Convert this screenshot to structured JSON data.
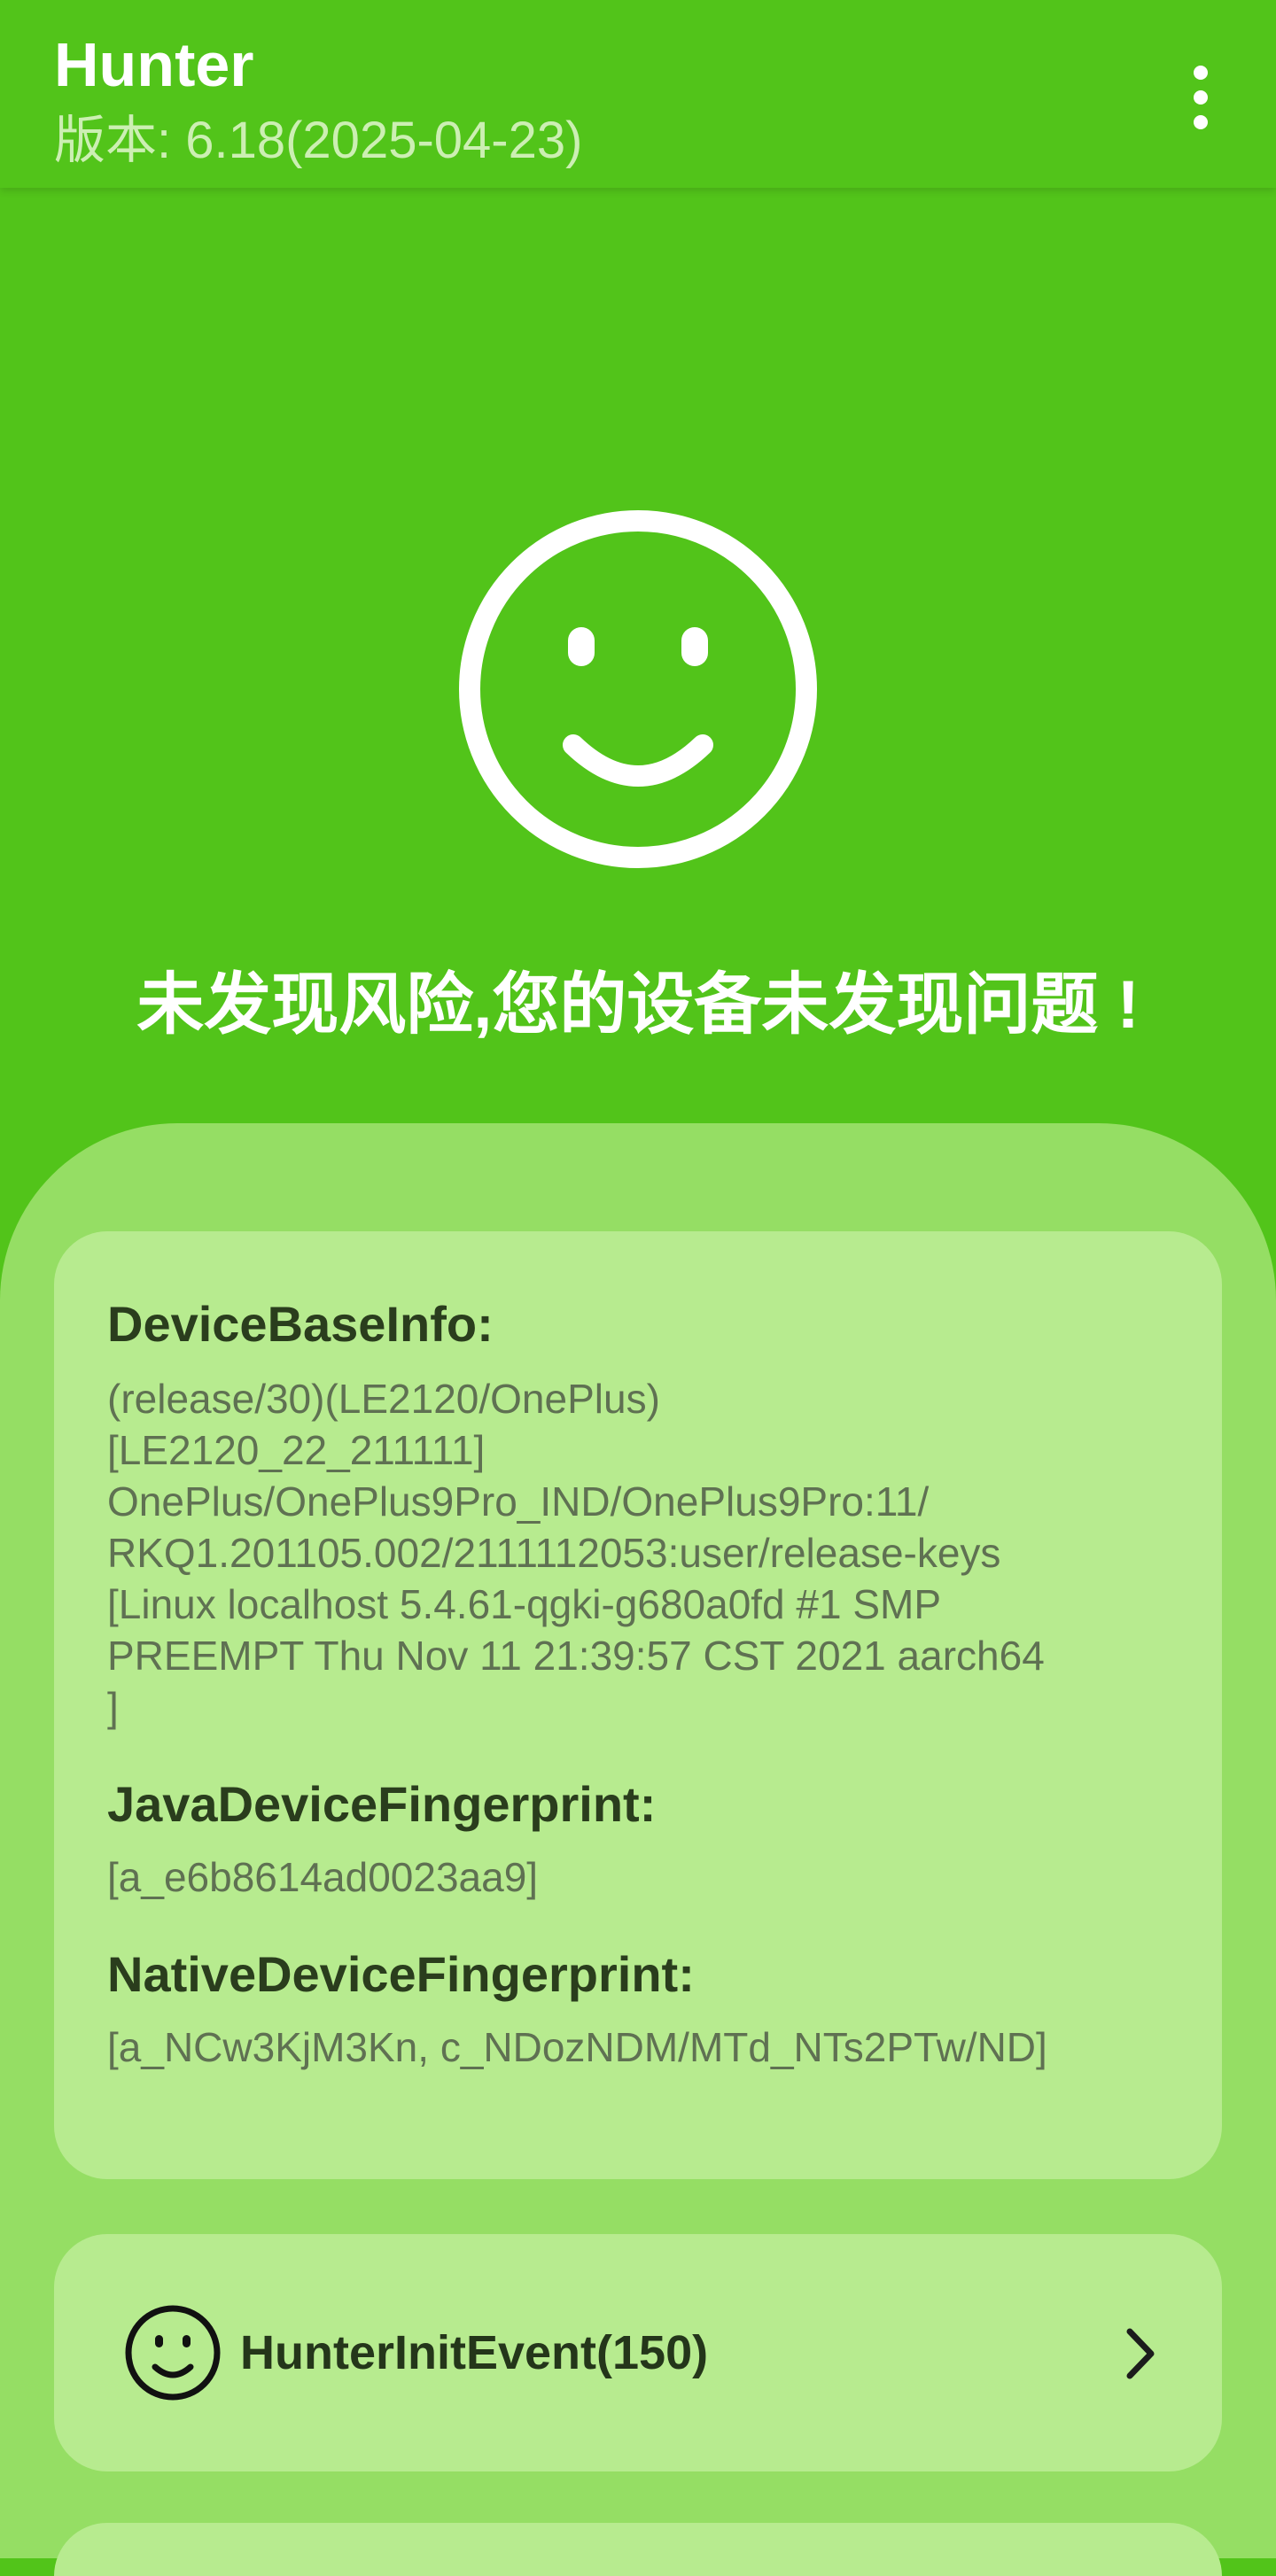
{
  "header": {
    "title": "Hunter",
    "version": "版本: 6.18(2025-04-23)",
    "menu_icon": "more-vertical-icon"
  },
  "hero": {
    "icon": "smiley-face-icon",
    "message": "未发现风险,您的设备未发现问题 !"
  },
  "info_card": {
    "device_base_info": {
      "title": "DeviceBaseInfo:",
      "lines": [
        "(release/30)(LE2120/OnePlus)",
        "[LE2120_22_211111]",
        "OnePlus/OnePlus9Pro_IND/OnePlus9Pro:11/",
        "RKQ1.201105.002/2111112053:user/release-keys",
        "[Linux localhost 5.4.61-qgki-g680a0fd #1 SMP",
        "PREEMPT Thu Nov 11 21:39:57 CST 2021 aarch64",
        "]"
      ]
    },
    "java_fingerprint": {
      "title": "JavaDeviceFingerprint:",
      "value": "[a_e6b8614ad0023aa9]"
    },
    "native_fingerprint": {
      "title": "NativeDeviceFingerprint:",
      "value": "[a_NCw3KjM3Kn, c_NDozNDM/MTd_NTs2PTw/ND]"
    }
  },
  "events": [
    {
      "icon": "smiley-face-icon",
      "label": "HunterInitEvent(150)",
      "arrow_icon": "chevron-right-icon"
    }
  ],
  "colors": {
    "primary": "#52c41a",
    "sheet": "#95de64",
    "card": "#b7eb8f"
  }
}
